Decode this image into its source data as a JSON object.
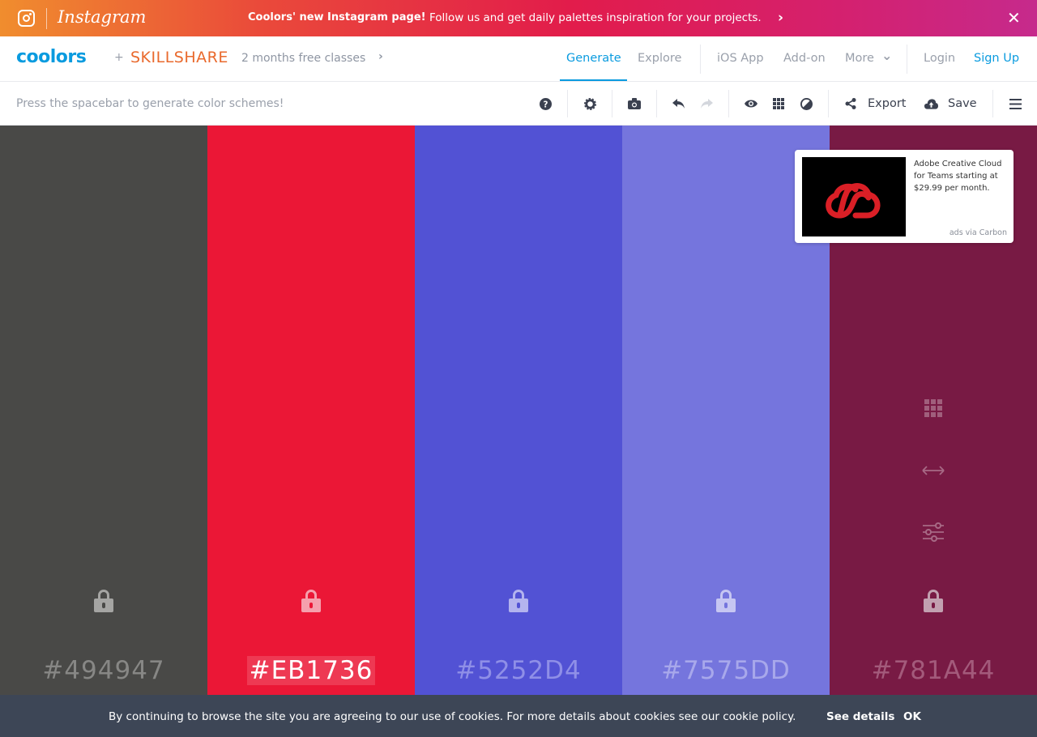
{
  "banner": {
    "brand": "Instagram",
    "headline": "Coolors' new Instagram page!",
    "text": "Follow us and get daily palettes inspiration for your projects.",
    "arrow": "›",
    "close": "✕"
  },
  "nav": {
    "logo": "coolors",
    "plus": "+",
    "partner": "SKILLSHARE",
    "promo": "2 months free classes",
    "promo_arrow": "›",
    "links": {
      "generate": "Generate",
      "explore": "Explore",
      "ios_app": "iOS App",
      "add_on": "Add-on",
      "more": "More",
      "more_caret": "⌄",
      "login": "Login",
      "signup": "Sign Up"
    }
  },
  "toolbar": {
    "hint": "Press the spacebar to generate color schemes!",
    "export_label": "Export",
    "save_label": "Save",
    "icons": [
      "help-icon",
      "settings-icon",
      "camera-icon",
      "undo-icon",
      "redo-icon",
      "eye-icon",
      "grid-icon",
      "contrast-icon",
      "share-icon",
      "cloud-upload-icon",
      "menu-icon"
    ]
  },
  "palette": {
    "swatches": [
      {
        "hex": "#494947",
        "color": "#494947",
        "text_color": "#878785",
        "lock_color": "#a5a5a3"
      },
      {
        "hex": "#EB1736",
        "color": "#EB1736",
        "text_color": "#ffffff",
        "lock_color": "#f5a0ad"
      },
      {
        "hex": "#5252D4",
        "color": "#5252D4",
        "text_color": "#8f8fe7",
        "lock_color": "#b3b3ee"
      },
      {
        "hex": "#7575DD",
        "color": "#7575DD",
        "text_color": "#a8a8eb",
        "lock_color": "#c6c6f2"
      },
      {
        "hex": "#781A44",
        "color": "#781A44",
        "text_color": "#a35a7b",
        "lock_color": "#c2a0b0"
      }
    ],
    "selected_index": 1
  },
  "ad": {
    "text": "Adobe Creative Cloud for Teams starting at $29.99 per month.",
    "via": "ads via Carbon"
  },
  "cookie": {
    "text": "By continuing to browse the site you are agreeing to our use of cookies. For more details about cookies see our cookie policy.",
    "details": "See details",
    "ok": "OK"
  }
}
